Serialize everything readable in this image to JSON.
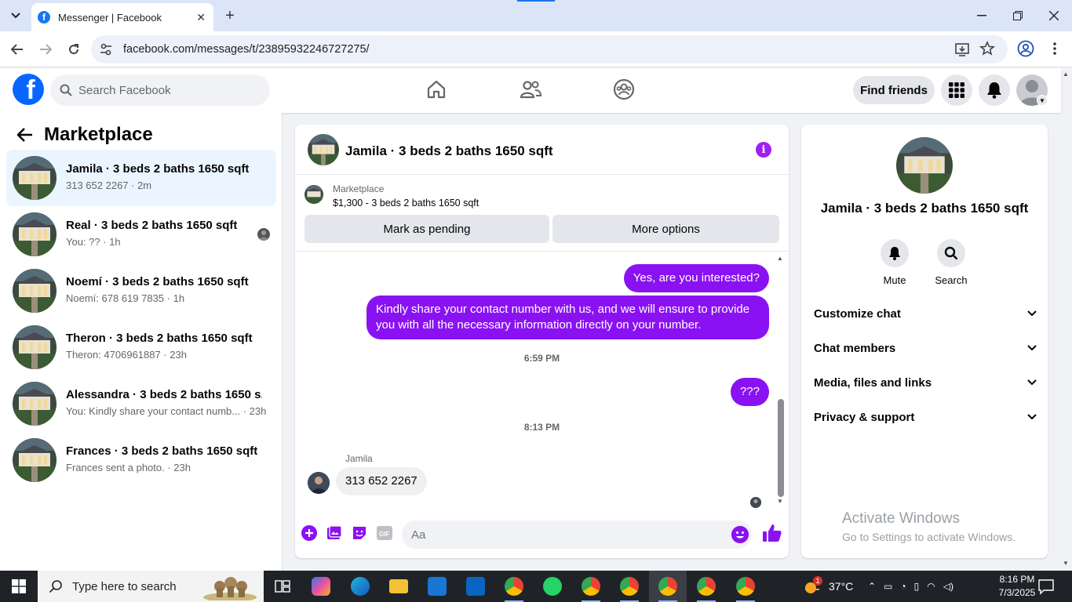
{
  "browser": {
    "tab_title": "Messenger | Facebook",
    "url": "facebook.com/messages/t/23895932246727275/"
  },
  "fb_header": {
    "search_placeholder": "Search Facebook",
    "find_friends_label": "Find friends"
  },
  "sidebar": {
    "title": "Marketplace",
    "conversations": [
      {
        "title": "Jamila · 3 beds 2 baths 1650 sqft",
        "subtitle": "313 652 2267 · 2m"
      },
      {
        "title": "Real · 3 beds 2 baths 1650 sqft",
        "subtitle": "You: ?? · 1h"
      },
      {
        "title": "Noemí · 3 beds 2 baths 1650 sqft",
        "subtitle": "Noemí: 678 619 7835 · 1h"
      },
      {
        "title": "Theron · 3 beds 2 baths 1650 sqft",
        "subtitle": "Theron: 4706961887 · 23h"
      },
      {
        "title": "Alessandra · 3 beds 2 baths 1650 s...",
        "subtitle": "You: Kindly share your contact numb... · 23h"
      },
      {
        "title": "Frances · 3 beds 2 baths 1650 sqft",
        "subtitle": "Frances sent a photo. · 23h"
      }
    ]
  },
  "chat": {
    "title": "Jamila · 3 beds 2 baths 1650 sqft",
    "marketplace_label": "Marketplace",
    "listing": "$1,300 - 3 beds 2 baths 1650 sqft",
    "mark_pending_label": "Mark as pending",
    "more_options_label": "More options",
    "messages": {
      "out_1": "Yes, are you interested?",
      "out_2": "Kindly share your contact number with us, and we will ensure to provide you with all the necessary information directly on your number.",
      "time_1": "6:59 PM",
      "out_3": "???",
      "time_2": "8:13 PM",
      "sender_name": "Jamila",
      "in_1": "313 652 2267"
    },
    "input_placeholder": "Aa"
  },
  "info_panel": {
    "name": "Jamila · 3 beds 2 baths 1650 sqft",
    "mute_label": "Mute",
    "search_label": "Search",
    "sections": [
      "Customize chat",
      "Chat members",
      "Media, files and links",
      "Privacy & support"
    ],
    "watermark_title": "Activate Windows",
    "watermark_sub": "Go to Settings to activate Windows."
  },
  "taskbar": {
    "search_placeholder": "Type here to search",
    "temperature": "37°C",
    "weather_badge": "1",
    "time": "8:16 PM",
    "date": "7/3/2025"
  },
  "colors": {
    "accent_purple": "#8a12f2",
    "facebook_blue": "#0866ff"
  }
}
